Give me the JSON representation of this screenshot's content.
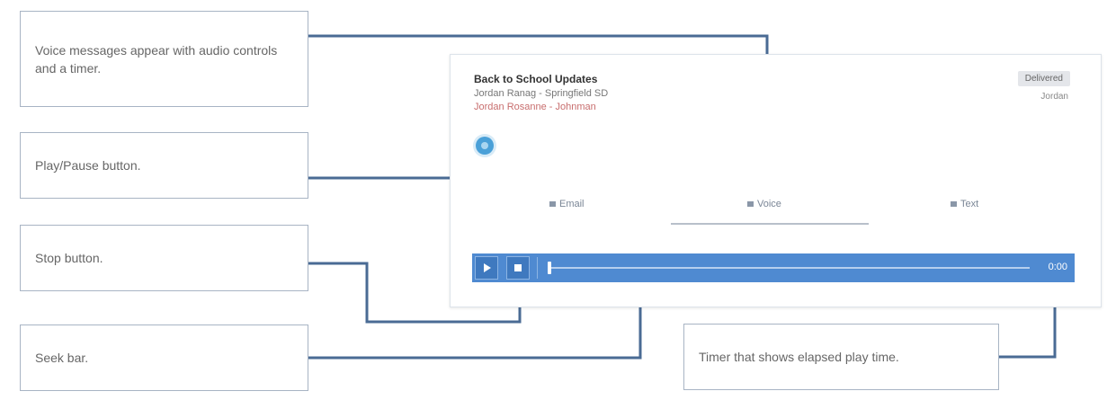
{
  "callouts": {
    "voice_messages": "Voice messages appear with audio controls and a timer.",
    "play_pause": "Play/Pause button.",
    "stop": "Stop button.",
    "seek": "Seek bar.",
    "timer": "Timer that shows elapsed play time."
  },
  "message": {
    "title": "Back to School Updates",
    "line1": "Jordan Ranag - Springfield SD",
    "line2": "Jordan Rosanne - Johnman",
    "status_badge": "Delivered",
    "status_sub": "Jordan"
  },
  "tabs": [
    {
      "label": "Email",
      "icon": "email-icon"
    },
    {
      "label": "Voice",
      "icon": "voice-icon"
    },
    {
      "label": "Text",
      "icon": "text-icon"
    }
  ],
  "player": {
    "timer": "0:00",
    "progress": 0
  },
  "colors": {
    "player_bar": "#4f8ad1",
    "connector": "#4a6b94",
    "callout_border": "#a8b4c4"
  }
}
